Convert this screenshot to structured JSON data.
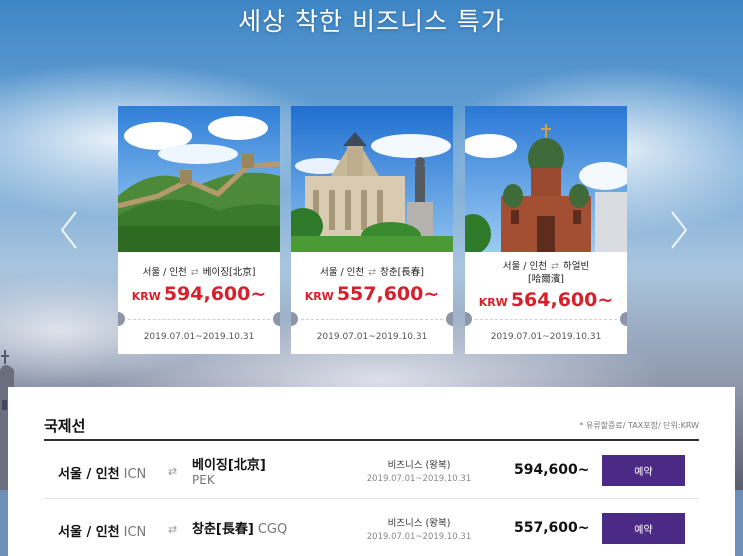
{
  "hero": {
    "title": "세상 착한 비즈니스 특가"
  },
  "carousel": {
    "prev_icon": "chevron-left-icon",
    "next_icon": "chevron-right-icon",
    "cards": [
      {
        "image": "great-wall-photo",
        "origin": "서울 / 인천",
        "destination": "베이징[北京]",
        "destination_line2": "",
        "currency": "KRW",
        "price": "594,600~",
        "dates": "2019.07.01~2019.10.31"
      },
      {
        "image": "changchun-building-photo",
        "origin": "서울 / 인천",
        "destination": "창춘[長春]",
        "destination_line2": "",
        "currency": "KRW",
        "price": "557,600~",
        "dates": "2019.07.01~2019.10.31"
      },
      {
        "image": "harbin-cathedral-photo",
        "origin": "서울 / 인천",
        "destination": "하얼빈",
        "destination_line2": "[哈爾濱]",
        "currency": "KRW",
        "price": "564,600~",
        "dates": "2019.07.01~2019.10.31"
      }
    ]
  },
  "international": {
    "title": "국제선",
    "note": "* 유류할증료/ TAX포함/ 단위:KRW",
    "rows": [
      {
        "origin": "서울 / 인천",
        "origin_code": "ICN",
        "destination": "베이징[北京]",
        "destination_code": "PEK",
        "class": "비즈니스 (왕복)",
        "dates": "2019.07.01~2019.10.31",
        "price": "594,600~",
        "button": "예약"
      },
      {
        "origin": "서울 / 인천",
        "origin_code": "ICN",
        "destination": "창춘[長春]",
        "destination_code": "CGQ",
        "class": "비즈니스 (왕복)",
        "dates": "2019.07.01~2019.10.31",
        "price": "557,600~",
        "button": "예약"
      }
    ]
  },
  "colors": {
    "price_red": "#d8202c",
    "button_purple": "#4b2a86"
  }
}
